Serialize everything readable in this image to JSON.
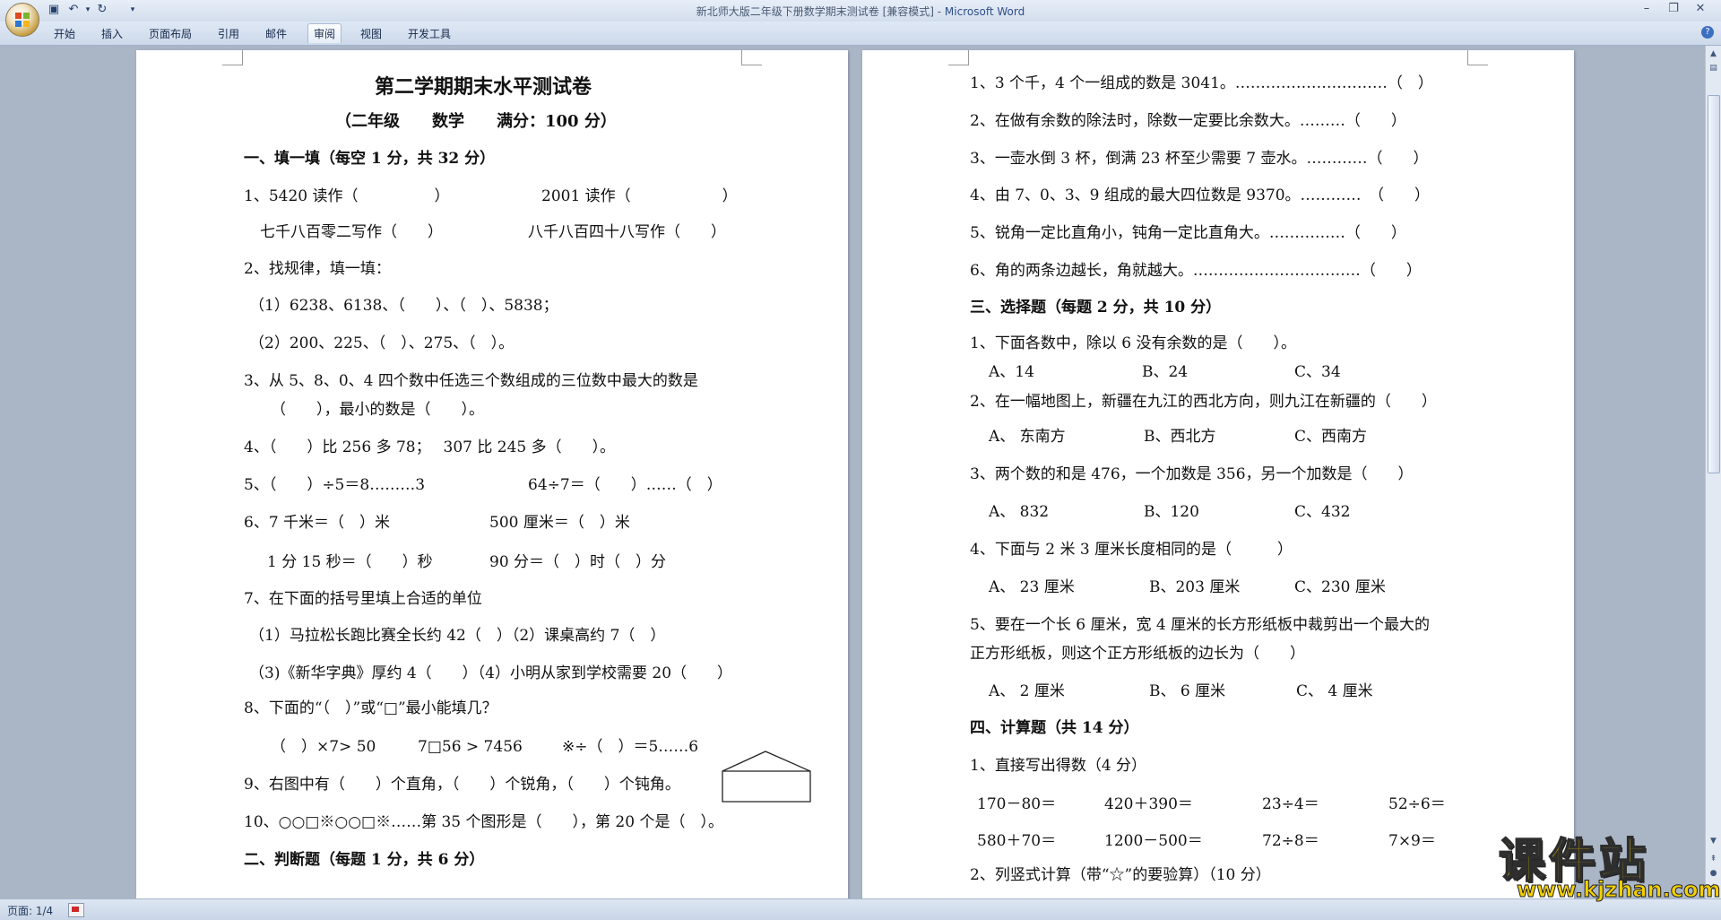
{
  "window": {
    "title": "新北师大版二年级下册数学期末测试卷 [兼容模式] - ",
    "app": "Microsoft Word"
  },
  "ribbon": {
    "tabs": [
      "开始",
      "插入",
      "页面布局",
      "引用",
      "邮件",
      "审阅",
      "视图",
      "开发工具"
    ],
    "active": "审阅"
  },
  "status": {
    "page": "页面: 1/4"
  },
  "watermark": {
    "main": "课件站",
    "url": "www.kjzhan.com"
  },
  "page1": {
    "title": "第二学期期末水平测试卷",
    "subtitle": "（二年级　　数学　　满分：100 分）",
    "s1": "一、填一填（每空 1 分，共 32 分）",
    "l1a": "1、5420 读作（　　　　　）",
    "l1b": "2001 读作（　　　　　　）",
    "l2a": "七千八百零二写作（　　）",
    "l2b": "八千八百四十八写作（　　）",
    "l3": "2、找规律，填一填：",
    "l4": "（1）6238、6138、（　　）、（　）、5838；",
    "l5": "（2）200、225、（　）、275、（　）。",
    "l6": "3、从 5、8、0、4 四个数中任选三个数组成的三位数中最大的数是",
    "l7": "（　　），最小的数是（　　）。",
    "l8": "4、（　　）比 256 多 78；　 307 比 245 多（　　）。",
    "l9a": "5、（　　）÷5＝8………3",
    "l9b": "64÷7＝（　　）……（　）",
    "l10a": "6、7 千米＝（　）米",
    "l10b": "500 厘米＝（　）米",
    "l11a": "1 分 15 秒＝（　　）秒",
    "l11b": "90 分＝（　）时（　）分",
    "l12": "7、在下面的括号里填上合适的单位",
    "l13": "（1）马拉松长跑比赛全长约 42（　）（2）课桌高约 7（　）",
    "l14": "（3)《新华字典》厚约 4（　　）（4）小明从家到学校需要 20（　　）",
    "l15": "8、下面的“（　）”或“□”最小能填几？",
    "l16a": "（　）×7> 50",
    "l16b": "7□56 > 7456",
    "l16c": "※÷（　）＝5……6",
    "l17": "9、右图中有（　　）个直角，（　　）个锐角，（　　）个钝角。",
    "l18": "10、○○□※○○□※……第 35 个图形是（　　），第 20 个是（　）。",
    "s2": "二、判断题（每题 1 分，共 6 分）"
  },
  "page2": {
    "j1": "1、3 个千，4 个一组成的数是 3041。…………………………（　）",
    "j2": "2、在做有余数的除法时，除数一定要比余数大。………（　　）",
    "j3": "3、一壶水倒 3 杯，倒满 23 杯至少需要 7 壶水。…………（　　）",
    "j4": "4、由 7、0、3、9 组成的最大四位数是 9370。…………　（　　）",
    "j5": "5、锐角一定比直角小，钝角一定比直角大。……………（　　）",
    "j6": "6、角的两条边越长，角就越大。……………………………（　　）",
    "s3": "三、选择题（每题 2 分，共 10 分）",
    "c1": "1、下面各数中，除以 6 没有余数的是（　　）。",
    "c1a": "A、14",
    "c1b": "B、24",
    "c1c": "C、34",
    "c2": "2、在一幅地图上，新疆在九江的西北方向，则九江在新疆的（　　）",
    "c2a": "A、 东南方",
    "c2b": "B、西北方",
    "c2c": "C、西南方",
    "c3": "3、两个数的和是 476，一个加数是 356，另一个加数是（　　）",
    "c3a": "A、 832",
    "c3b": "B、120",
    "c3c": "C、432",
    "c4": "4、下面与 2 米 3 厘米长度相同的是（　　　）",
    "c4a": "A、 23 厘米",
    "c4b": "B、203 厘米",
    "c4c": "C、230 厘米",
    "c5": "5、要在一个长 6 厘米，宽 4 厘米的长方形纸板中裁剪出一个最大的",
    "c5b": "正方形纸板，则这个正方形纸板的边长为（　　）",
    "c5o1": "A、 2 厘米",
    "c5o2": "B、 6 厘米",
    "c5o3": "C、 4 厘米",
    "s4": "四、计算题（共 14 分）",
    "k1": "1、直接写出得数（4 分）",
    "k1a": "170－80＝",
    "k1b": "420＋390＝",
    "k1c": "23÷4＝",
    "k1d": "52÷6＝",
    "k2a": "580＋70＝",
    "k2b": "1200－500＝",
    "k2c": "72÷8＝",
    "k2d": "7×9＝",
    "k3": "2、列竖式计算（带“☆”的要验算）（10 分）"
  }
}
